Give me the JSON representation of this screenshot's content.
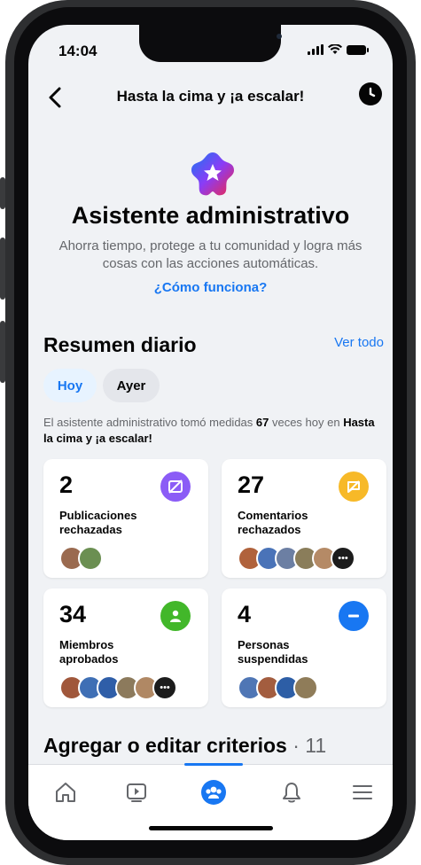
{
  "status": {
    "time": "14:04"
  },
  "header": {
    "title": "Hasta la cima y ¡a escalar!"
  },
  "hero": {
    "title": "Asistente administrativo",
    "subtitle": "Ahorra tiempo, protege a tu comunidad y logra más cosas con las acciones automáticas.",
    "link": "¿Cómo funciona?"
  },
  "summary_section": {
    "title": "Resumen diario",
    "see_all": "Ver todo",
    "chips": [
      "Hoy",
      "Ayer"
    ],
    "selected_chip": "Hoy",
    "text_before": "El asistente administrativo tomó medidas ",
    "count": "67",
    "text_middle": " veces hoy en ",
    "group": "Hasta la cima y ¡a escalar!"
  },
  "cards": [
    {
      "number": "2",
      "label": "Publicaciones rechazadas",
      "icon": "rejected-post-icon",
      "color": "#8b5cf6"
    },
    {
      "number": "27",
      "label": "Comentarios rechazados",
      "icon": "rejected-comment-icon",
      "color": "#f7b928"
    },
    {
      "number": "34",
      "label": "Miembros aprobados",
      "icon": "approved-member-icon",
      "color": "#42b72a"
    },
    {
      "number": "4",
      "label": "Personas suspendidas",
      "icon": "suspended-person-icon",
      "color": "#1877f2"
    }
  ],
  "criteria": {
    "title": "Agregar o editar criterios",
    "count": "· 11"
  },
  "tabbar": {
    "items": [
      "home-icon",
      "video-icon",
      "groups-icon",
      "notifications-icon",
      "menu-icon"
    ],
    "active": "groups-icon",
    "active_color": "#1877f2"
  }
}
